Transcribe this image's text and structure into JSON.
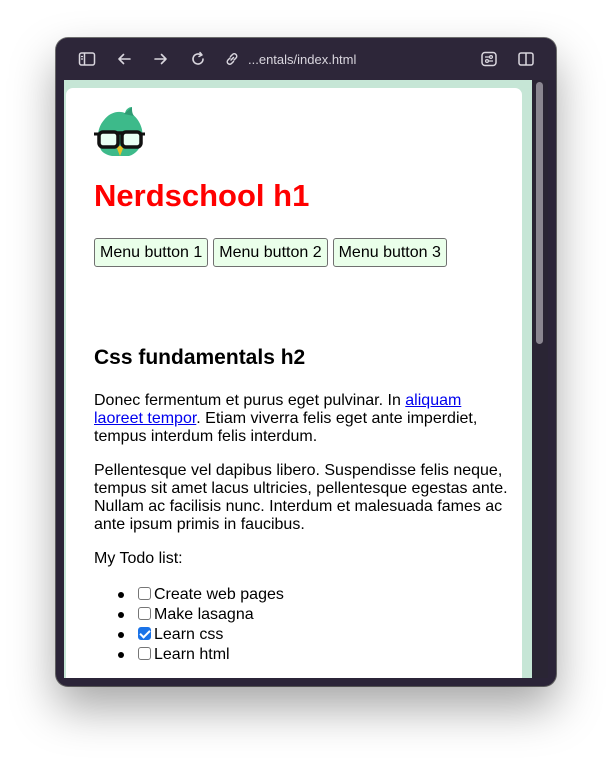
{
  "browser": {
    "url": "...entals/index.html",
    "icons": [
      "sidebar-icon",
      "back-arrow-icon",
      "forward-arrow-icon",
      "reload-icon",
      "link-icon",
      "extensions-icon",
      "split-view-icon"
    ]
  },
  "page": {
    "h1": "Nerdschool h1",
    "menu": [
      "Menu button 1",
      "Menu button 2",
      "Menu button 3"
    ],
    "h2": "Css fundamentals h2",
    "para1": {
      "before": "Donec fermentum et purus eget pulvinar. In ",
      "link": "aliquam laoreet tempor",
      "after": ". Etiam viverra felis eget ante imperdiet, tempus interdum felis interdum."
    },
    "para2": "Pellentesque vel dapibus libero. Suspendisse felis neque, tempus sit amet lacus ultricies, pellentesque egestas ante. Nullam ac facilisis nunc. Interdum et malesuada fames ac ante ipsum primis in faucibus.",
    "todo_label": "My Todo list:",
    "todos": [
      {
        "label": "Create web pages",
        "checked": false
      },
      {
        "label": "Make lasagna",
        "checked": false
      },
      {
        "label": "Learn css",
        "checked": true
      },
      {
        "label": "Learn html",
        "checked": false
      }
    ]
  },
  "colors": {
    "heading_red": "#ff0000",
    "page_bg": "#c6e6d6",
    "button_bg": "#eaffea",
    "link": "#0000ee",
    "checkbox_checked": "#1a73e8",
    "window_chrome": "#2d2639"
  }
}
